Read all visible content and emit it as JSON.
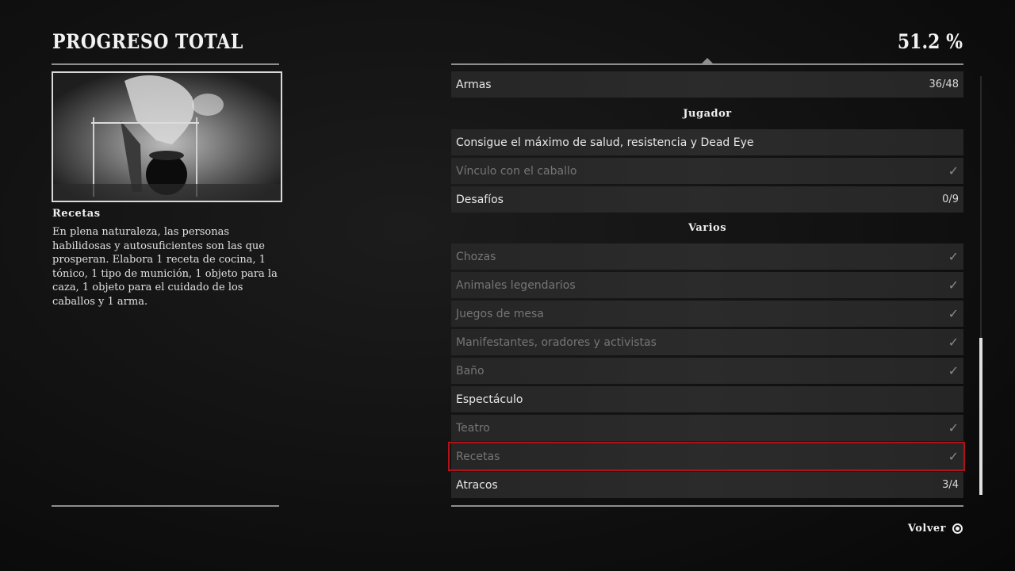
{
  "header": {
    "title": "PROGRESO TOTAL",
    "percent": "51.2 %"
  },
  "detail": {
    "image_icon": "cooking-pot-photo",
    "title": "Recetas",
    "text": "En plena naturaleza, las personas habilidosas y autosuficientes son las que prosperan. Elabora 1 receta de cocina, 1 tónico, 1 tipo de munición, 1 objeto para la caza, 1 objeto para el cuidado de los caballos y 1 arma."
  },
  "list": {
    "row_armas": {
      "label": "Armas",
      "value": "36/48"
    },
    "section_jugador": "Jugador",
    "row_salud": {
      "label": "Consigue el máximo de salud, resistencia y Dead Eye"
    },
    "row_vinculo": {
      "label": "Vínculo con el caballo",
      "check": "✓"
    },
    "row_desafios": {
      "label": "Desafíos",
      "value": "0/9"
    },
    "section_varios": "Varios",
    "row_chozas": {
      "label": "Chozas",
      "check": "✓"
    },
    "row_animales": {
      "label": "Animales legendarios",
      "check": "✓"
    },
    "row_juegos": {
      "label": "Juegos de mesa",
      "check": "✓"
    },
    "row_manifestantes": {
      "label": "Manifestantes, oradores y activistas",
      "check": "✓"
    },
    "row_bano": {
      "label": "Baño",
      "check": "✓"
    },
    "row_espectaculo": {
      "label": "Espectáculo"
    },
    "row_teatro": {
      "label": "Teatro",
      "check": "✓"
    },
    "row_recetas": {
      "label": "Recetas",
      "check": "✓"
    },
    "row_atracos": {
      "label": "Atracos",
      "value": "3/4"
    }
  },
  "footer": {
    "back_label": "Volver",
    "back_icon": "circle-button-icon"
  },
  "colors": {
    "selection": "#b0121a",
    "completed_text": "#767676",
    "row_bg": "#292929"
  }
}
